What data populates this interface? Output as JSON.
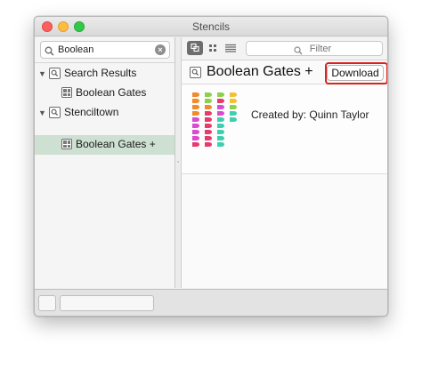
{
  "window": {
    "title": "Stencils"
  },
  "search": {
    "value": "Boolean",
    "placeholder": ""
  },
  "sidebar": {
    "items": [
      {
        "label": "Search Results",
        "level": 0,
        "expanded": true
      },
      {
        "label": "Boolean Gates",
        "level": 1
      },
      {
        "label": "Stenciltown",
        "level": 0,
        "expanded": true
      },
      {
        "label": "Boolean Gates +",
        "level": 1,
        "selected": true
      }
    ]
  },
  "toolbar": {
    "filter_placeholder": "Filter",
    "views": [
      "icon-view",
      "grid-view",
      "list-view"
    ],
    "active_view": "icon-view"
  },
  "detail": {
    "title": "Boolean Gates +",
    "download_label": "Download",
    "creator": "Created by: Quinn Taylor"
  },
  "colors": {
    "selection": "#cde0d1",
    "highlight": "#d9251d",
    "gate_colors": [
      "#f08a2a",
      "#8bd14a",
      "#d94bd0",
      "#e63b6c",
      "#3ccfb0",
      "#f2c033"
    ]
  }
}
